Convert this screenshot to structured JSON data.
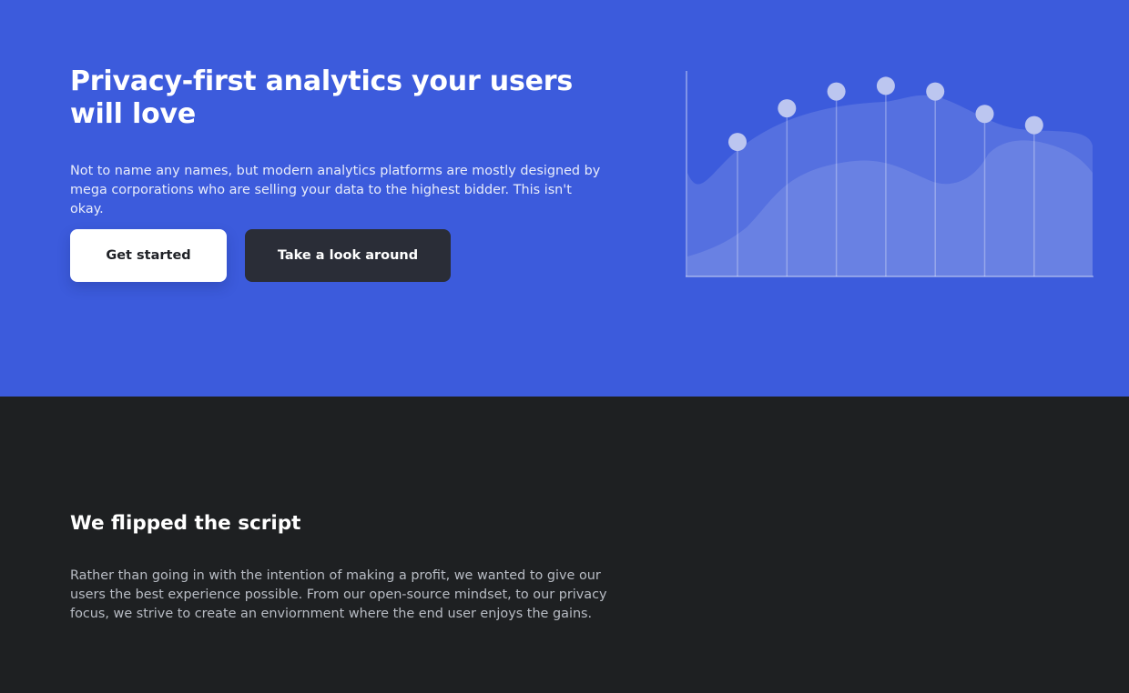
{
  "hero": {
    "title": "Privacy-first analytics your users will love",
    "description": "Not to name any names, but modern analytics platforms are mostly designed by mega corporations who are selling your data to the highest bidder. This isn't okay.",
    "primary_button": "Get started",
    "secondary_button": "Take a look around",
    "background_color": "#3c5bdc"
  },
  "illustration": {
    "type": "area",
    "points": [
      1.2,
      3.0,
      3.9,
      4.2,
      3.9,
      2.7,
      2.1
    ],
    "ylim": [
      -6.0,
      5.0
    ]
  },
  "section": {
    "title": "We flipped the script",
    "description": "Rather than going in with the intention of making a profit, we wanted to give our users the best experience possible. From our open-source mindset, to our privacy focus, we strive to create an enviornment where the end user enjoys the gains.",
    "background_color": "#1e2022"
  }
}
